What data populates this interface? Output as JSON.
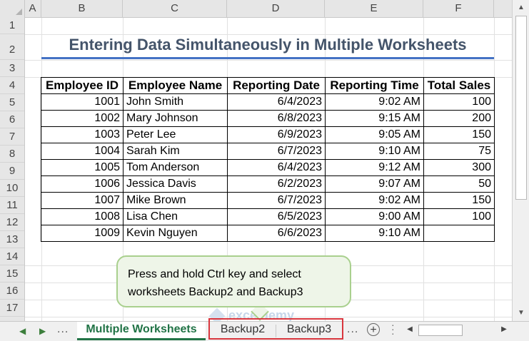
{
  "columns": [
    "A",
    "B",
    "C",
    "D",
    "E",
    "F"
  ],
  "rows": [
    "1",
    "2",
    "3",
    "4",
    "5",
    "6",
    "7",
    "8",
    "9",
    "10",
    "11",
    "12",
    "13",
    "14",
    "15",
    "16",
    "17"
  ],
  "title": "Entering Data  Simultaneously   in Multiple Worksheets",
  "table": {
    "headers": [
      "Employee ID",
      "Employee Name",
      "Reporting Date",
      "Reporting Time",
      "Total Sales"
    ],
    "rows": [
      [
        "1001",
        "John Smith",
        "6/4/2023",
        "9:02 AM",
        "100"
      ],
      [
        "1002",
        "Mary Johnson",
        "6/8/2023",
        "9:15 AM",
        "200"
      ],
      [
        "1003",
        "Peter Lee",
        "6/9/2023",
        "9:05 AM",
        "150"
      ],
      [
        "1004",
        "Sarah Kim",
        "6/7/2023",
        "9:10 AM",
        "75"
      ],
      [
        "1005",
        "Tom Anderson",
        "6/4/2023",
        "9:12 AM",
        "300"
      ],
      [
        "1006",
        "Jessica Davis",
        "6/2/2023",
        "9:07 AM",
        "50"
      ],
      [
        "1007",
        "Mike Brown",
        "6/7/2023",
        "9:02 AM",
        "150"
      ],
      [
        "1008",
        "Lisa Chen",
        "6/5/2023",
        "9:00 AM",
        "100"
      ],
      [
        "1009",
        "Kevin Nguyen",
        "6/6/2023",
        "9:10 AM",
        ""
      ]
    ]
  },
  "callout": {
    "line1": "Press and hold Ctrl key and select",
    "line2": "worksheets Backup2 and Backup3"
  },
  "watermark": "exceldemy",
  "tabs": {
    "prev": "◀",
    "next": "▶",
    "more_left": "...",
    "active": "Multiple Worksheets",
    "backup2": "Backup2",
    "backup3": "Backup3",
    "more_right": "...",
    "add": "+"
  },
  "colors": {
    "title": "#44546a",
    "title_underline": "#4472c4",
    "active_tab": "#217346",
    "callout_fill": "#eef5e8",
    "callout_border": "#a9d08e",
    "highlight_box": "#d9363e"
  },
  "icons": [
    "select-all-icon",
    "scroll-up-icon",
    "scroll-down-icon",
    "add-sheet-icon",
    "scroll-left-icon",
    "scroll-right-icon"
  ]
}
